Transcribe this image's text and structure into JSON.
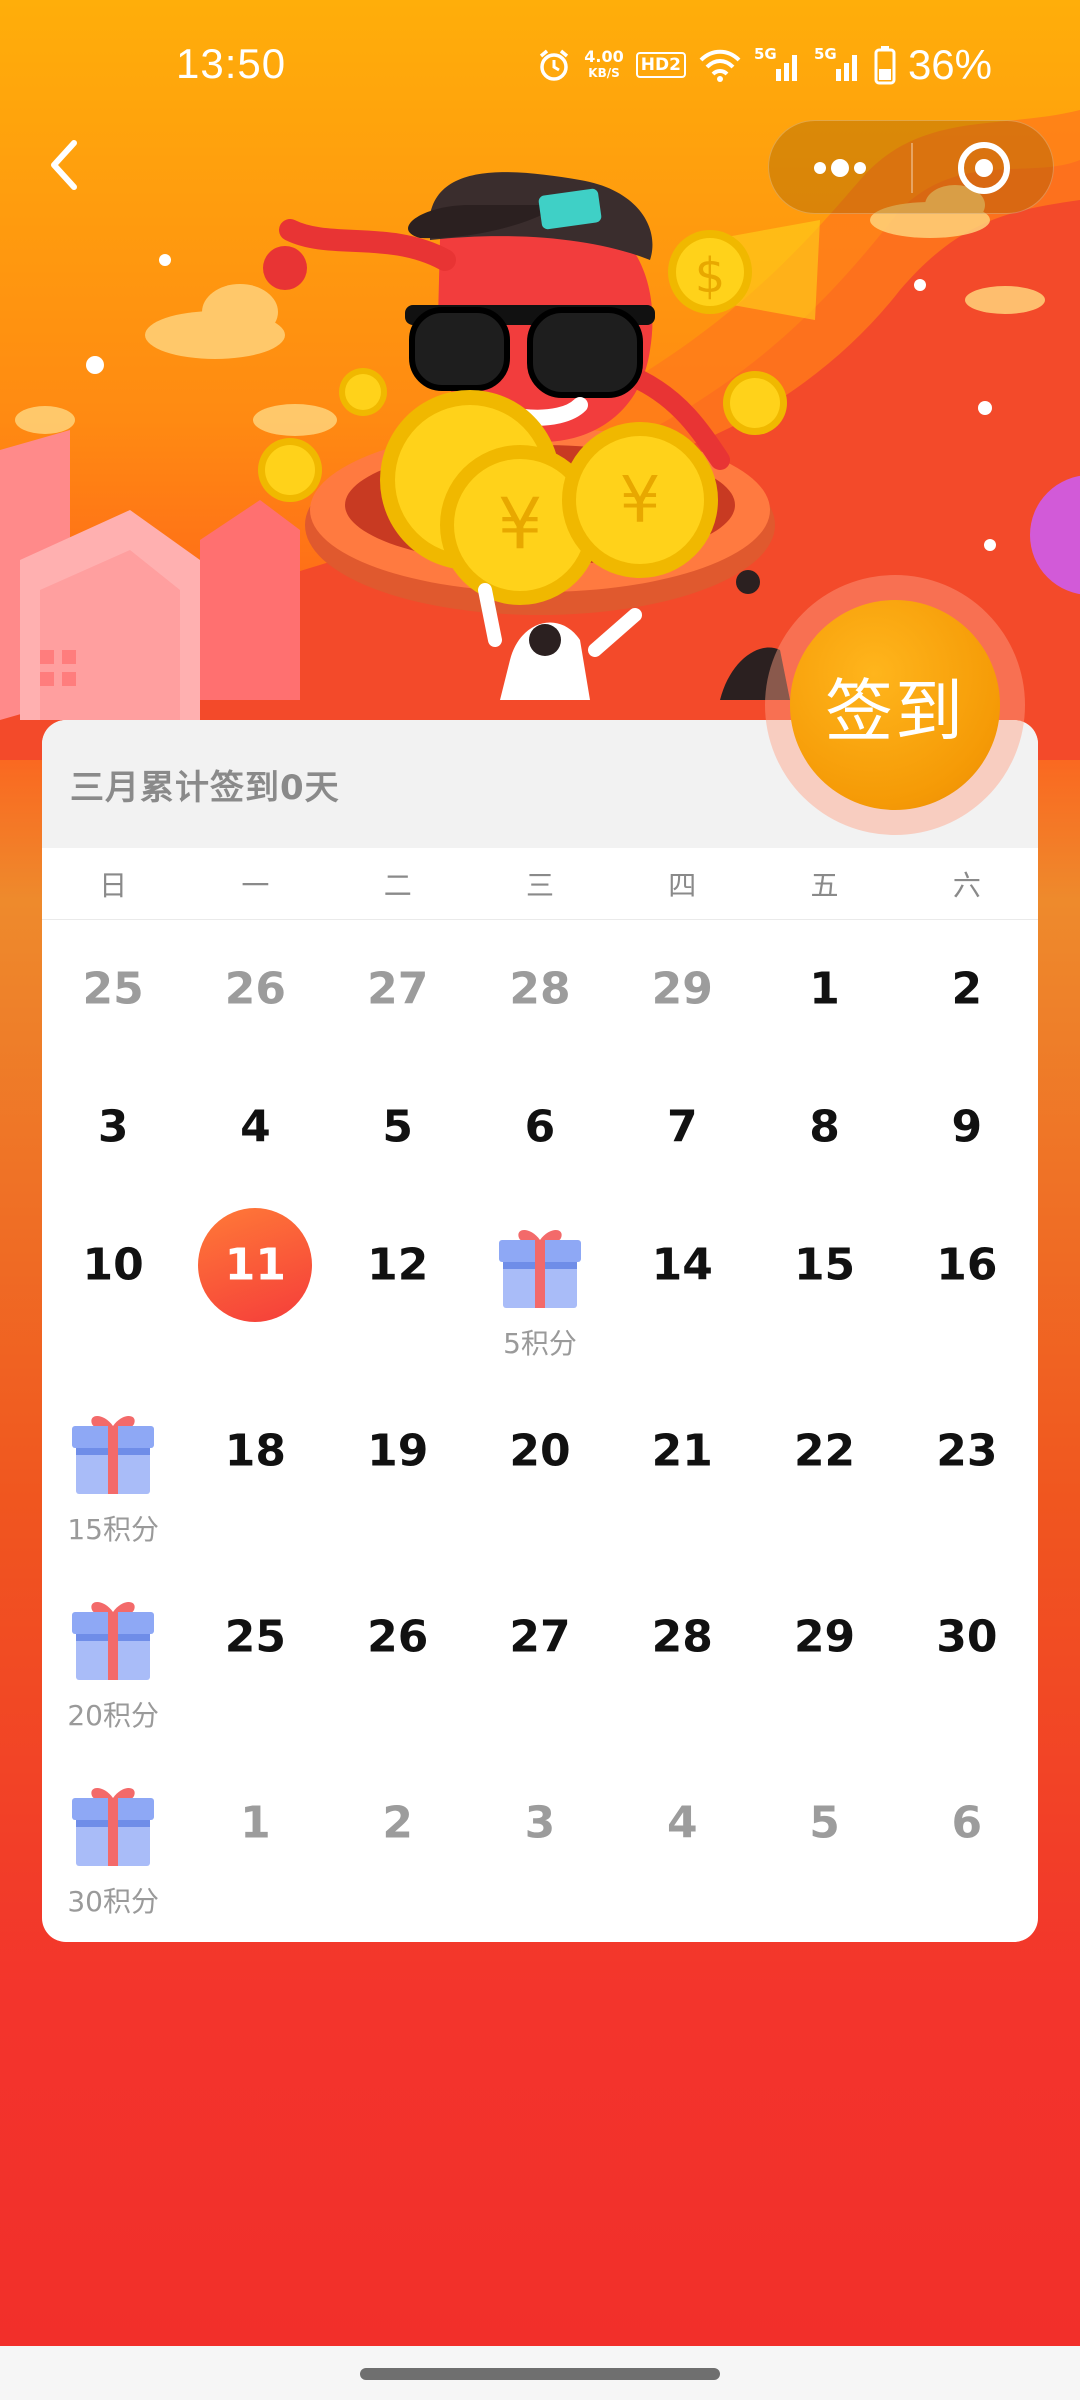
{
  "status_bar": {
    "time": "13:50",
    "net_speed_value": "4.00",
    "net_speed_unit": "KB/S",
    "hd_badge": "HD2",
    "signal_1": "5G",
    "signal_2": "5G",
    "battery_percent": "36%",
    "icons": [
      "alarm-icon",
      "wifi-icon",
      "signal-5g-icon",
      "signal-5g-icon",
      "battery-icon"
    ]
  },
  "nav": {
    "back_icon": "chevron-left-icon",
    "capsule_icons": [
      "more-dots-icon",
      "target-close-icon"
    ]
  },
  "sign_button": {
    "label": "签到"
  },
  "calendar": {
    "summary": "三月累计签到0天",
    "weekdays": [
      "日",
      "一",
      "二",
      "三",
      "四",
      "五",
      "六"
    ],
    "weeks": [
      [
        {
          "day": "25",
          "other": true
        },
        {
          "day": "26",
          "other": true
        },
        {
          "day": "27",
          "other": true
        },
        {
          "day": "28",
          "other": true
        },
        {
          "day": "29",
          "other": true
        },
        {
          "day": "1"
        },
        {
          "day": "2"
        }
      ],
      [
        {
          "day": "3"
        },
        {
          "day": "4"
        },
        {
          "day": "5"
        },
        {
          "day": "6"
        },
        {
          "day": "7"
        },
        {
          "day": "8"
        },
        {
          "day": "9"
        }
      ],
      [
        {
          "day": "10"
        },
        {
          "day": "11",
          "today": true
        },
        {
          "day": "12"
        },
        {
          "gift": true,
          "label": "5积分"
        },
        {
          "day": "14"
        },
        {
          "day": "15"
        },
        {
          "day": "16"
        }
      ],
      [
        {
          "gift": true,
          "label": "15积分"
        },
        {
          "day": "18"
        },
        {
          "day": "19"
        },
        {
          "day": "20"
        },
        {
          "day": "21"
        },
        {
          "day": "22"
        },
        {
          "day": "23"
        }
      ],
      [
        {
          "gift": true,
          "label": "20积分"
        },
        {
          "day": "25"
        },
        {
          "day": "26"
        },
        {
          "day": "27"
        },
        {
          "day": "28"
        },
        {
          "day": "29"
        },
        {
          "day": "30"
        }
      ],
      [
        {
          "gift": true,
          "label": "30积分"
        },
        {
          "day": "1",
          "other": true
        },
        {
          "day": "2",
          "other": true
        },
        {
          "day": "3",
          "other": true
        },
        {
          "day": "4",
          "other": true
        },
        {
          "day": "5",
          "other": true
        },
        {
          "day": "6",
          "other": true
        }
      ]
    ]
  },
  "colors": {
    "accent_orange": "#f59a06",
    "today_red": "#f53d3a",
    "gift_blue": "#9db3f7",
    "gift_ribbon": "#f36a6a"
  }
}
